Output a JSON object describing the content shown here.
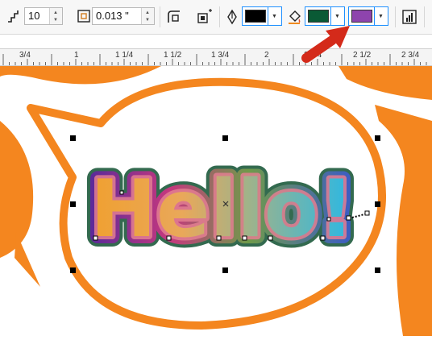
{
  "toolbar": {
    "steps_value": "10",
    "offset_value": "0.013 \"",
    "outline_color": "#000000",
    "fill_color": "#0a5a35",
    "end_color": "#8e44ad"
  },
  "ruler": {
    "labels": [
      "3/4",
      "1",
      "1 1/4",
      "1 1/2",
      "1 3/4",
      "2",
      "2 1/4",
      "2 1/2",
      "2 3/4"
    ]
  },
  "canvas": {
    "text": "Hello!",
    "accent_color": "#f4861f",
    "arrow_color": "#d42a1a"
  },
  "icons": {
    "steps": "steps-icon",
    "offset": "contour-offset-icon",
    "corner": "corner-icon",
    "acceleration": "acceleration-icon",
    "outline_pen": "pen-nib-icon",
    "fill_bucket": "fill-bucket-icon",
    "copy": "copy-properties-icon"
  }
}
